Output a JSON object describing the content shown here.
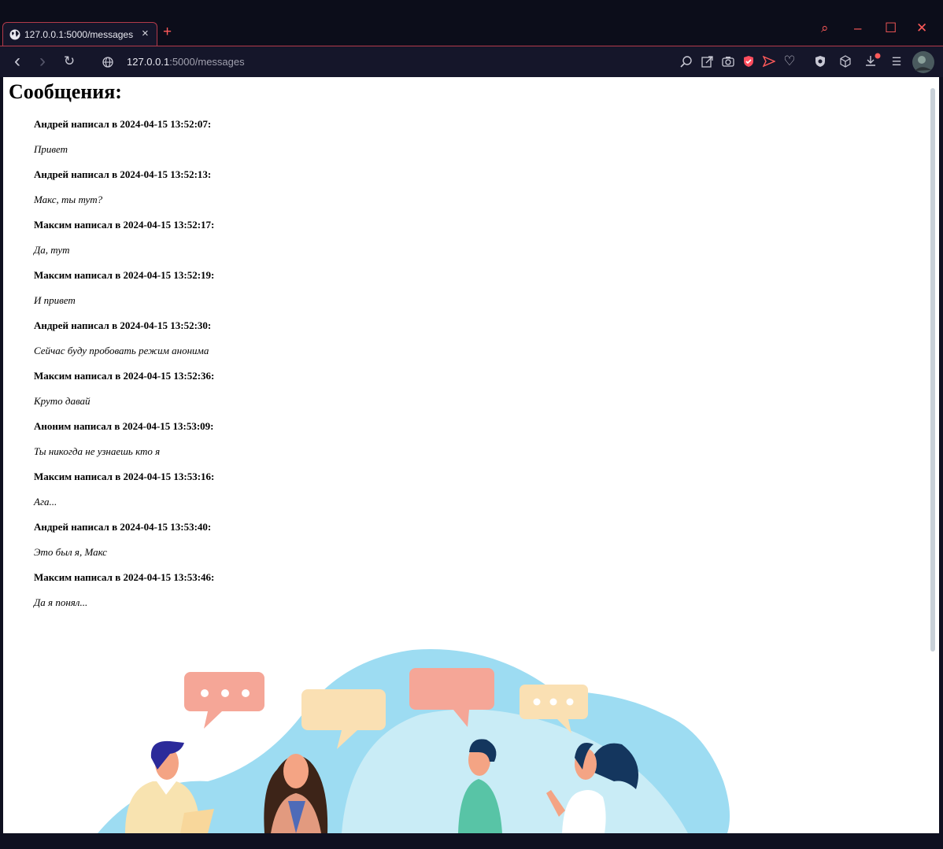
{
  "browser": {
    "tab_title": "127.0.0.1:5000/messages",
    "url_host": "127.0.0.1",
    "url_rest": ":5000/messages",
    "accent": "#ff5a5a"
  },
  "icons": {
    "close": "×",
    "new_tab": "+",
    "back": "‹",
    "forward": "›",
    "reload": "↻",
    "search": "⌕",
    "minimize": "–",
    "maximize": "☐",
    "window_close": "✕",
    "heart": "♡",
    "settings": "☰"
  },
  "page": {
    "heading": "Сообщения:",
    "messages": [
      {
        "header": "Андрей написал в 2024-04-15 13:52:07:",
        "text": "Привет"
      },
      {
        "header": "Андрей написал в 2024-04-15 13:52:13:",
        "text": "Макс, ты тут?"
      },
      {
        "header": "Максим написал в 2024-04-15 13:52:17:",
        "text": "Да, тут"
      },
      {
        "header": "Максим написал в 2024-04-15 13:52:19:",
        "text": "И привет"
      },
      {
        "header": "Андрей написал в 2024-04-15 13:52:30:",
        "text": "Сейчас буду пробовать режим анонима"
      },
      {
        "header": "Максим написал в 2024-04-15 13:52:36:",
        "text": "Круто давай"
      },
      {
        "header": "Аноним написал в 2024-04-15 13:53:09:",
        "text": "Ты никогда не узнаешь кто я"
      },
      {
        "header": "Максим написал в 2024-04-15 13:53:16:",
        "text": "Ага..."
      },
      {
        "header": "Андрей написал в 2024-04-15 13:53:40:",
        "text": "Это был я, Макс"
      },
      {
        "header": "Максим написал в 2024-04-15 13:53:46:",
        "text": "Да я понял..."
      }
    ]
  }
}
